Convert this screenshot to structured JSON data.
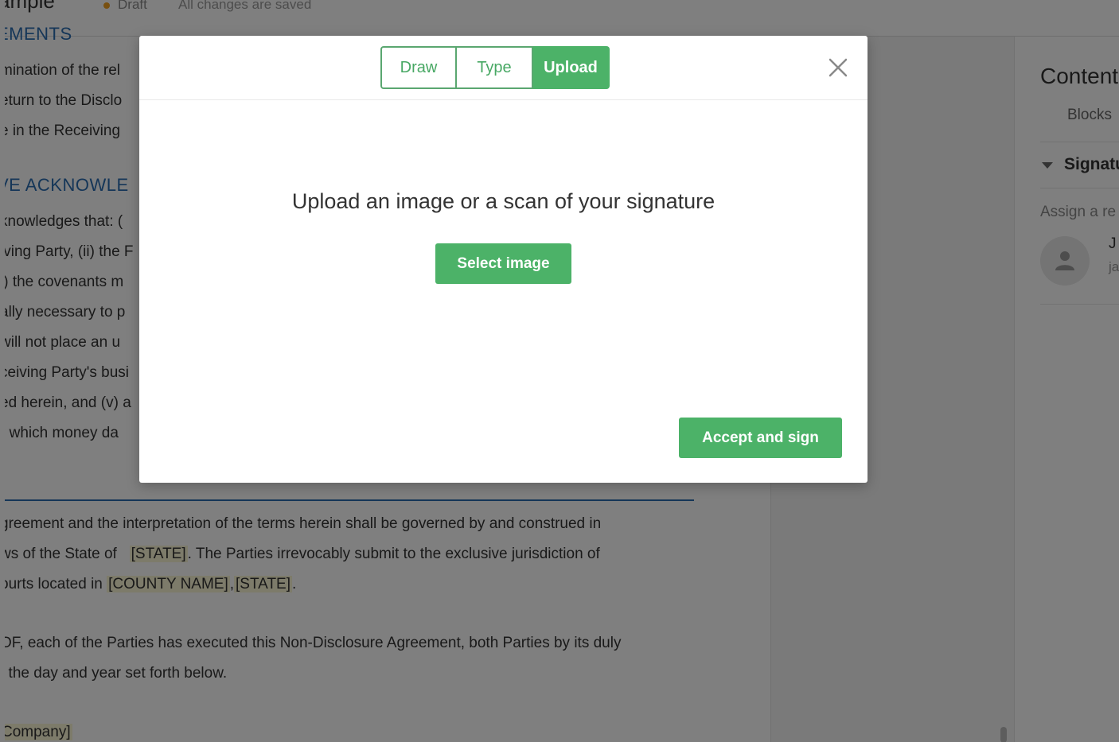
{
  "topbar": {
    "doc_title": "ample",
    "draft_label": "Draft",
    "saved_label": "All changes are saved"
  },
  "document": {
    "section_top": "EMENTS",
    "lines_top": [
      "mination of the rel",
      "eturn to the Disclo",
      "e in the Receiving"
    ],
    "section_ack": "VE ACKNOWLE",
    "lines_ack": [
      "knowledges that: (",
      "iving Party, (ii) the F",
      "i) the covenants m",
      "ally necessary to p",
      "will not place an u",
      "ceiving Party's busi",
      "ed herein, and (v) a",
      "r which money da"
    ],
    "law_line1": "greement and the interpretation of the terms herein shall be governed by and construed in",
    "law_line2_a": "ws of the State of",
    "law_state": "[STATE]",
    "law_line2_b": ". The Parties irrevocably submit to the exclusive jurisdiction of",
    "law_line3_a": "ourts located in",
    "law_county": "[COUNTY NAME]",
    "law_sep": ",",
    "law_state2": "[STATE]",
    "law_end": ".",
    "witness_line1": "OF, each of the Parties has executed this Non-Disclosure Agreement, both Parties by its duly",
    "witness_line2": "f the day and year set forth below.",
    "company_placeholder": "Company]"
  },
  "right_panel": {
    "title": "Content",
    "tab_blocks": "Blocks",
    "section": "Signature",
    "assign_label": "Assign a re",
    "assignee_initial": "J",
    "assignee_email": "ja"
  },
  "modal": {
    "tabs": [
      "Draw",
      "Type",
      "Upload"
    ],
    "active_tab": "Upload",
    "prompt": "Upload an image or a scan of your signature",
    "select_label": "Select image",
    "accept_label": "Accept and sign"
  },
  "colors": {
    "accent": "#4cb268",
    "link_blue": "#2b6cb0",
    "placeholder_bg": "#fbf6d4",
    "draft_dot": "#f0a020"
  }
}
